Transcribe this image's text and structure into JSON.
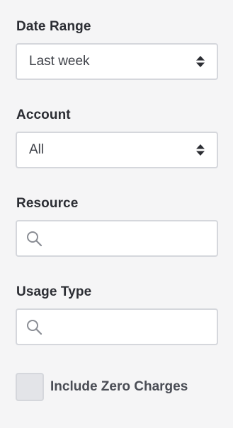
{
  "filters": {
    "date_range": {
      "label": "Date Range",
      "value": "Last week",
      "icon": "sort-arrows-icon"
    },
    "account": {
      "label": "Account",
      "value": "All",
      "icon": "sort-arrows-icon"
    },
    "resource": {
      "label": "Resource",
      "placeholder": "",
      "icon": "search-icon"
    },
    "usage_type": {
      "label": "Usage Type",
      "placeholder": "",
      "icon": "search-icon"
    },
    "include_zero_charges": {
      "label": "Include Zero Charges",
      "checked": false
    }
  },
  "colors": {
    "background": "#f5f5f6",
    "field_border": "#d5d7dc",
    "checkbox_fill": "#e3e4e8",
    "text": "#2b2d33"
  }
}
